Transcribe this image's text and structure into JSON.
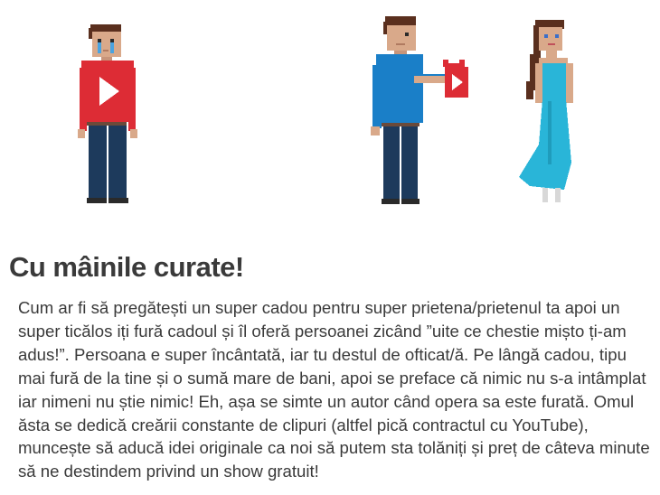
{
  "article": {
    "title": "Cu mâinile curate!",
    "body": "Cum ar fi să pregătești un super cadou pentru super prietena/prietenul ta apoi un super ticălos iți fură cadoul și îl oferă persoanei zicând ”uite ce chestie mișto ți-am adus!”. Persoana e super încântată, iar tu destul de ofticat/ă. Pe lângă cadou, tipu mai fură de la tine și o sumă mare de bani, apoi se preface că nimic nu s-a intâmplat iar nimeni nu știe nimic! Eh, așa se simte un autor când opera sa este furată. Omul ăsta se dedică creării constante de clipuri (altfel pică contractul cu YouTube), muncește să aducă idei originale ca noi să putem sta tolăniți și preț de câteva minute să ne destindem privind un show gratuit!"
  },
  "colors": {
    "red_shirt": "#dd2c35",
    "blue_shirt": "#1a7fc8",
    "dress": "#29b5d8",
    "pants": "#1d3a5c",
    "skin": "#d9a98a",
    "hair": "#5a2f1e"
  }
}
